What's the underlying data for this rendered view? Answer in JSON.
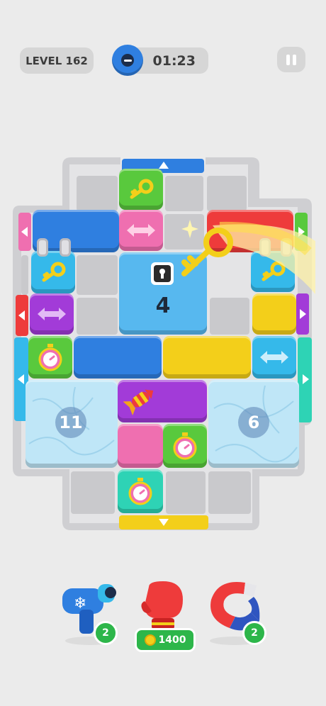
{
  "header": {
    "level_label": "LEVEL 162",
    "timer": "01:23",
    "timer_icon": "minus-icon",
    "pause_icon": "pause-icon"
  },
  "board": {
    "key_lock_count": "4",
    "ice_left_count": "11",
    "ice_right_count": "6",
    "items": [
      "key-icon",
      "arrow-horizontal-icon",
      "stopwatch-icon",
      "rocket-icon",
      "lock-icon"
    ]
  },
  "boosters": [
    {
      "name": "freeze-gun",
      "count": "2"
    },
    {
      "name": "boxing-glove",
      "cost": "1400"
    },
    {
      "name": "magnet",
      "count": "2"
    }
  ],
  "colors": {
    "blue": "#2f7fe0",
    "pink": "#ef6fb0",
    "green": "#59c93d",
    "purple": "#a23bd8",
    "yellow": "#f3cf1a",
    "red": "#ee3b3b",
    "cyan": "#35b9ea",
    "ice": "#bfe6f7"
  }
}
